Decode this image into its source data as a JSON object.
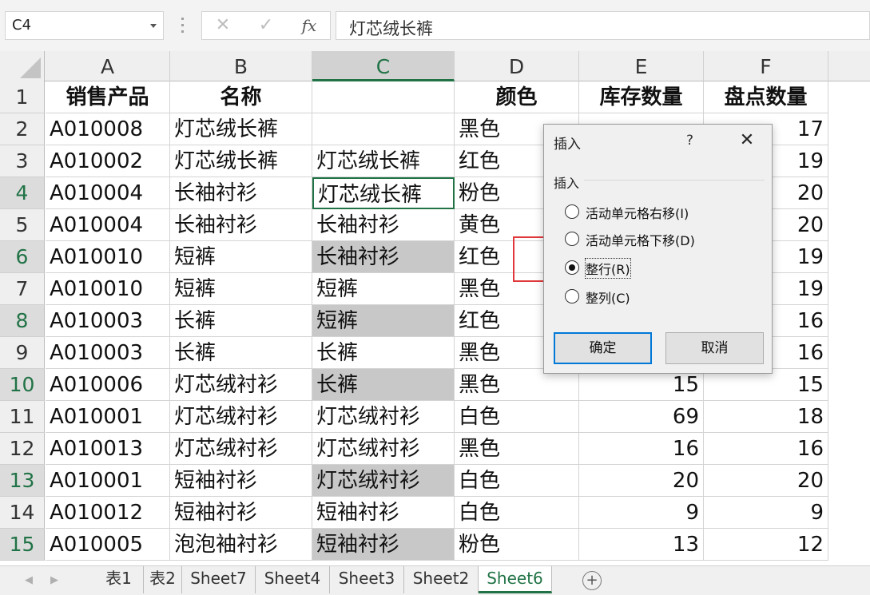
{
  "namebox": {
    "value": "C4"
  },
  "formula": {
    "cancel_icon": "✕",
    "confirm_icon": "✓",
    "fx_label": "fx",
    "value": "灯芯绒长裤"
  },
  "columns": [
    "A",
    "B",
    "C",
    "D",
    "E",
    "F"
  ],
  "rows": [
    {
      "num": "1",
      "cells": [
        "销售产品",
        "名称",
        "",
        "颜色",
        "库存数量",
        "盘点数量"
      ]
    },
    {
      "num": "2",
      "cells": [
        "A010008",
        "灯芯绒长裤",
        "",
        "黑色",
        "",
        "17"
      ]
    },
    {
      "num": "3",
      "cells": [
        "A010002",
        "灯芯绒长裤",
        "灯芯绒长裤",
        "红色",
        "",
        "19"
      ]
    },
    {
      "num": "4",
      "cells": [
        "A010004",
        "长袖衬衫",
        "灯芯绒长裤",
        "粉色",
        "",
        "20"
      ]
    },
    {
      "num": "5",
      "cells": [
        "A010004",
        "长袖衬衫",
        "长袖衬衫",
        "黄色",
        "",
        "20"
      ]
    },
    {
      "num": "6",
      "cells": [
        "A010010",
        "短裤",
        "长袖衬衫",
        "红色",
        "",
        "19"
      ]
    },
    {
      "num": "7",
      "cells": [
        "A010010",
        "短裤",
        "短裤",
        "黑色",
        "",
        "19"
      ]
    },
    {
      "num": "8",
      "cells": [
        "A010003",
        "长裤",
        "短裤",
        "红色",
        "",
        "16"
      ]
    },
    {
      "num": "9",
      "cells": [
        "A010003",
        "长裤",
        "长裤",
        "黑色",
        "",
        "16"
      ]
    },
    {
      "num": "10",
      "cells": [
        "A010006",
        "灯芯绒衬衫",
        "长裤",
        "黑色",
        "15",
        "15"
      ]
    },
    {
      "num": "11",
      "cells": [
        "A010001",
        "灯芯绒衬衫",
        "灯芯绒衬衫",
        "白色",
        "69",
        "18"
      ]
    },
    {
      "num": "12",
      "cells": [
        "A010013",
        "灯芯绒衬衫",
        "灯芯绒衬衫",
        "黑色",
        "16",
        "16"
      ]
    },
    {
      "num": "13",
      "cells": [
        "A010001",
        "短袖衬衫",
        "灯芯绒衬衫",
        "白色",
        "20",
        "20"
      ]
    },
    {
      "num": "14",
      "cells": [
        "A010012",
        "短袖衬衫",
        "短袖衬衫",
        "白色",
        "9",
        "9"
      ]
    },
    {
      "num": "15",
      "cells": [
        "A010005",
        "泡泡袖衬衫",
        "短袖衬衫",
        "粉色",
        "13",
        "12"
      ]
    }
  ],
  "sheets": [
    "表1",
    "表2",
    "Sheet7",
    "Sheet4",
    "Sheet3",
    "Sheet2",
    "Sheet6"
  ],
  "active_sheet": "Sheet6",
  "dialog": {
    "title": "插入",
    "help": "?",
    "close_icon": "✕",
    "group_label": "插入",
    "options": [
      {
        "label": "活动单元格右移(I)",
        "selected": false
      },
      {
        "label": "活动单元格下移(D)",
        "selected": false
      },
      {
        "label": "整行(R)",
        "selected": true
      },
      {
        "label": "整列(C)",
        "selected": false
      }
    ],
    "ok": "确定",
    "cancel": "取消"
  },
  "colors": {
    "accent_green": "#217346",
    "highlight_gray": "#c8c8c8",
    "annotation_red": "#e0393b",
    "dialog_focus_blue": "#0078d7"
  }
}
